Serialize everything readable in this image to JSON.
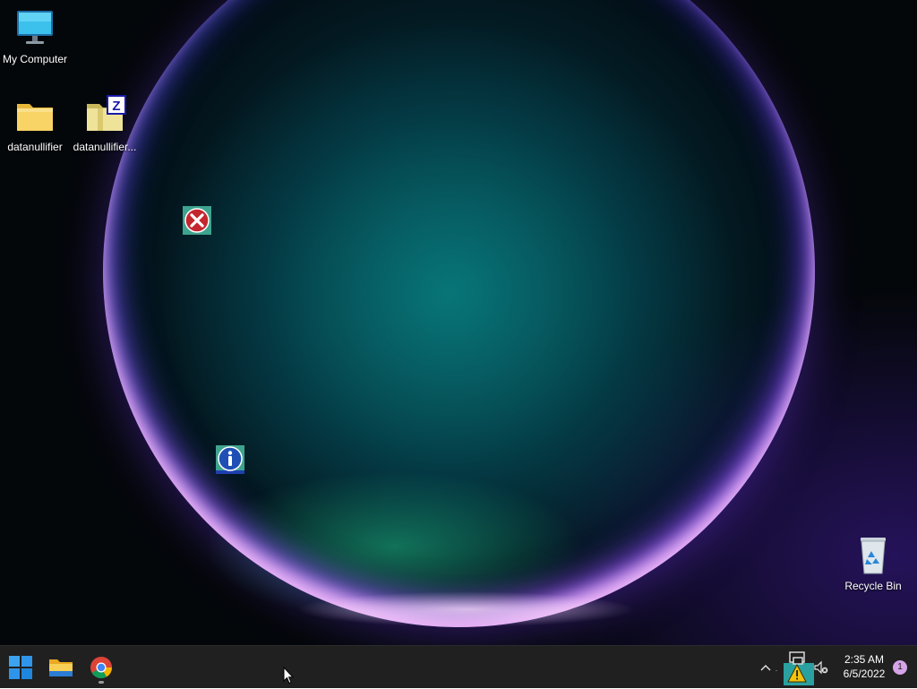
{
  "desktop": {
    "icons": [
      {
        "label": "My Computer",
        "icon": "monitor-icon"
      },
      {
        "label": "datanullifier",
        "icon": "folder-icon"
      },
      {
        "label": "datanullifier...",
        "icon": "zip-folder-icon"
      },
      {
        "label": "Recycle Bin",
        "icon": "recycle-bin-icon"
      }
    ],
    "floating_icons": [
      {
        "icon": "error-icon"
      },
      {
        "icon": "info-icon"
      }
    ]
  },
  "taskbar": {
    "pinned": [
      {
        "icon": "windows-start-icon"
      },
      {
        "icon": "file-explorer-icon"
      },
      {
        "icon": "chrome-icon"
      }
    ],
    "tray": {
      "icons": [
        "chevron-up-icon",
        "network-icon",
        "warning-icon",
        "volume-muted-icon"
      ],
      "time": "2:35 AM",
      "date": "6/5/2022",
      "notification_count": "1"
    }
  },
  "colors": {
    "taskbar": "#202020",
    "accent": "#0078d4",
    "error": "#c4262e",
    "info": "#1f4fb5",
    "notification_badge": "#d5a5e8"
  }
}
